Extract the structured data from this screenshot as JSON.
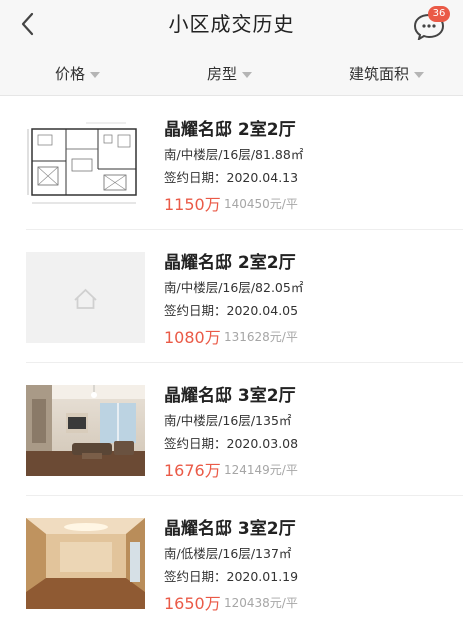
{
  "header": {
    "title": "小区成交历史",
    "message_count": "36"
  },
  "filters": [
    {
      "label": "价格"
    },
    {
      "label": "房型"
    },
    {
      "label": "建筑面积"
    }
  ],
  "listings": [
    {
      "title": "晶耀名邸 2室2厅",
      "info": "南/中楼层/16层/81.88㎡",
      "date": "签约日期：2020.04.13",
      "price": "1150万",
      "unit_price": "140450元/平",
      "image": "floor-plan"
    },
    {
      "title": "晶耀名邸 2室2厅",
      "info": "南/中楼层/16层/82.05㎡",
      "date": "签约日期：2020.04.05",
      "price": "1080万",
      "unit_price": "131628元/平",
      "image": "placeholder"
    },
    {
      "title": "晶耀名邸 3室2厅",
      "info": "南/中楼层/16层/135㎡",
      "date": "签约日期：2020.03.08",
      "price": "1676万",
      "unit_price": "124149元/平",
      "image": "living-room-photo"
    },
    {
      "title": "晶耀名邸 3室2厅",
      "info": "南/低楼层/16层/137㎡",
      "date": "签约日期：2020.01.19",
      "price": "1650万",
      "unit_price": "120438元/平",
      "image": "empty-room-photo"
    }
  ],
  "colors": {
    "accent": "#ea5a47",
    "muted": "#a6a6a6",
    "header_bg": "#f7f7f7"
  },
  "icons": [
    "back-arrow-icon",
    "chat-bubble-icon",
    "dropdown-caret-icon",
    "home-placeholder-icon"
  ]
}
